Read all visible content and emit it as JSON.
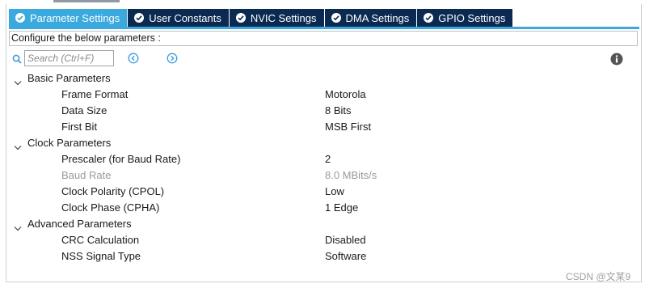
{
  "tabs": [
    {
      "label": "Parameter Settings",
      "active": true
    },
    {
      "label": "User Constants",
      "active": false
    },
    {
      "label": "NVIC Settings",
      "active": false
    },
    {
      "label": "DMA Settings",
      "active": false
    },
    {
      "label": "GPIO Settings",
      "active": false
    }
  ],
  "caption": "Configure the below parameters :",
  "search": {
    "placeholder": "Search (Ctrl+F)",
    "value": ""
  },
  "groups": [
    {
      "label": "Basic Parameters",
      "params": [
        {
          "label": "Frame Format",
          "value": "Motorola",
          "disabled": false
        },
        {
          "label": "Data Size",
          "value": "8 Bits",
          "disabled": false
        },
        {
          "label": "First Bit",
          "value": "MSB First",
          "disabled": false
        }
      ]
    },
    {
      "label": "Clock Parameters",
      "params": [
        {
          "label": "Prescaler (for Baud Rate)",
          "value": "2",
          "disabled": false
        },
        {
          "label": "Baud Rate",
          "value": "8.0 MBits/s",
          "disabled": true
        },
        {
          "label": "Clock Polarity (CPOL)",
          "value": "Low",
          "disabled": false
        },
        {
          "label": "Clock Phase (CPHA)",
          "value": "1 Edge",
          "disabled": false
        }
      ]
    },
    {
      "label": "Advanced Parameters",
      "params": [
        {
          "label": "CRC Calculation",
          "value": "Disabled",
          "disabled": false
        },
        {
          "label": "NSS Signal Type",
          "value": "Software",
          "disabled": false
        }
      ]
    }
  ],
  "watermark": "CSDN @文某9",
  "colors": {
    "tab_active": "#39a9de",
    "tab_inactive": "#0b2a52",
    "disabled_text": "#9a9a9a",
    "icon_blue": "#3d9be0",
    "info_icon": "#555555"
  },
  "icons": {
    "tab_check": "check-circle-icon",
    "search": "search-icon",
    "prev": "circle-chevron-left-icon",
    "next": "circle-chevron-right-icon",
    "info": "info-icon",
    "group_expander": "chevron-down-icon"
  }
}
